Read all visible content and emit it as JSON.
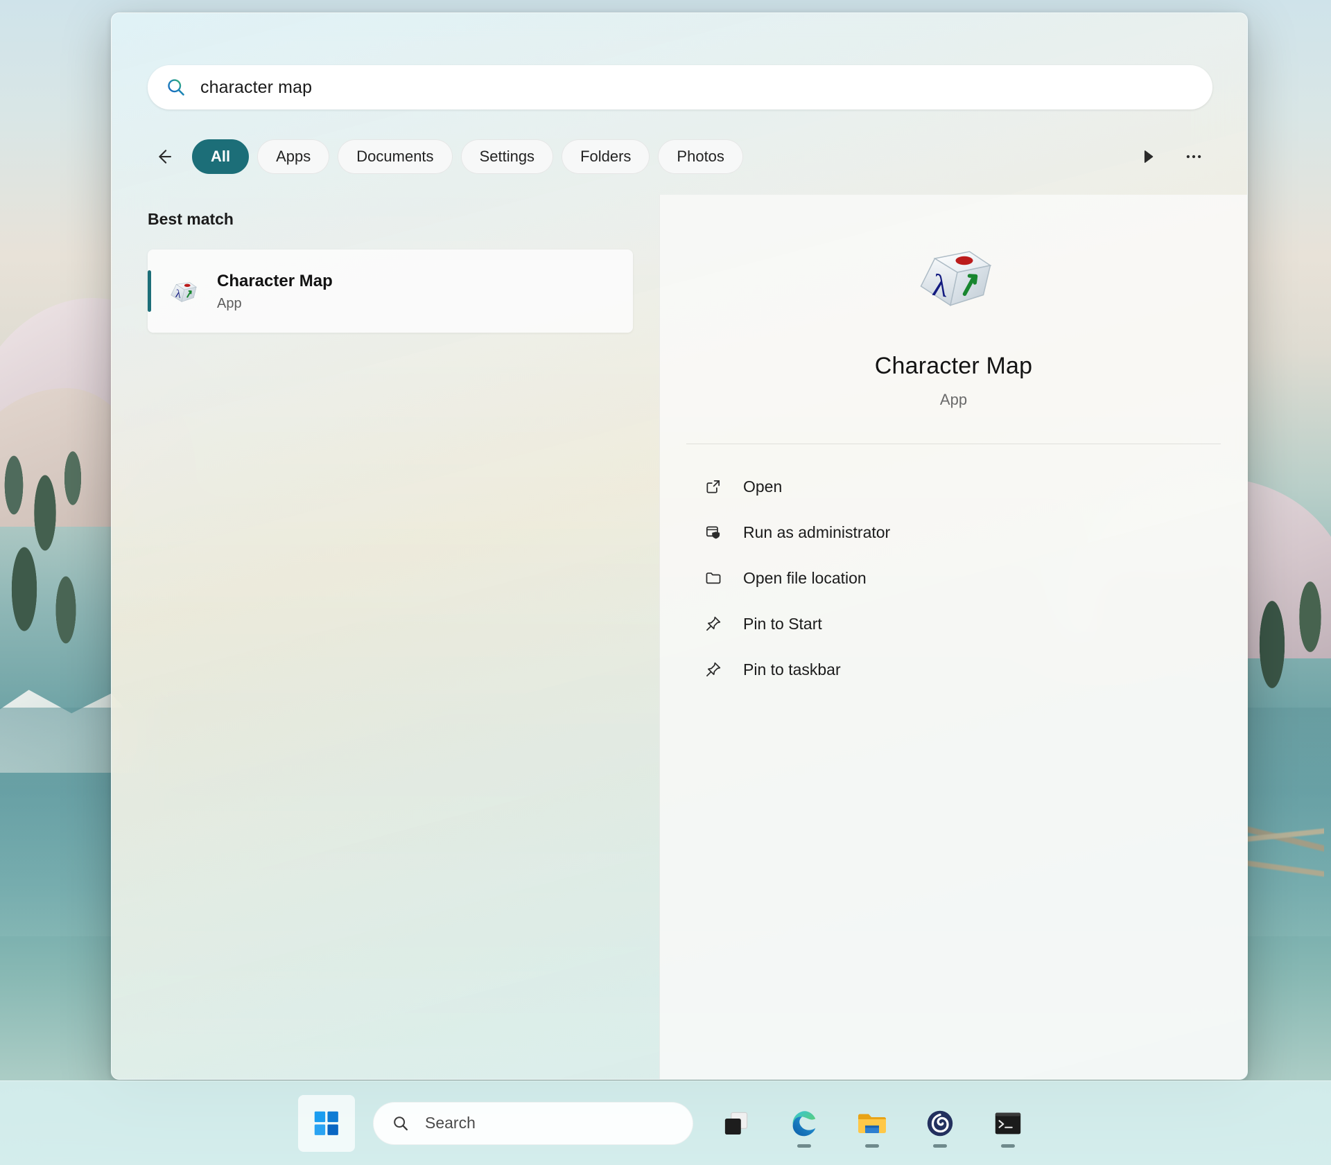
{
  "search": {
    "query": "character map",
    "icon": "search-icon"
  },
  "filters": {
    "back_icon": "back-arrow-icon",
    "tabs": [
      {
        "label": "All",
        "active": true
      },
      {
        "label": "Apps",
        "active": false
      },
      {
        "label": "Documents",
        "active": false
      },
      {
        "label": "Settings",
        "active": false
      },
      {
        "label": "Folders",
        "active": false
      },
      {
        "label": "Photos",
        "active": false
      }
    ],
    "play_icon": "play-icon",
    "more_icon": "ellipsis-icon"
  },
  "results": {
    "section_label": "Best match",
    "item": {
      "title": "Character Map",
      "subtitle": "App",
      "icon": "character-map-app-icon"
    }
  },
  "detail": {
    "icon": "character-map-app-icon",
    "title": "Character Map",
    "subtitle": "App",
    "actions": [
      {
        "label": "Open",
        "icon": "open-external-icon"
      },
      {
        "label": "Run as administrator",
        "icon": "shield-admin-icon"
      },
      {
        "label": "Open file location",
        "icon": "folder-icon"
      },
      {
        "label": "Pin to Start",
        "icon": "pin-icon"
      },
      {
        "label": "Pin to taskbar",
        "icon": "pin-icon"
      }
    ]
  },
  "taskbar": {
    "start_icon": "windows-start-icon",
    "search_placeholder": "Search",
    "search_icon": "search-icon",
    "apps": [
      {
        "name": "task-view",
        "running": false
      },
      {
        "name": "microsoft-edge",
        "running": true
      },
      {
        "name": "file-explorer",
        "running": true
      },
      {
        "name": "power-app",
        "running": true
      },
      {
        "name": "terminal",
        "running": true
      }
    ]
  },
  "colors": {
    "accent_teal": "#1c6e78",
    "selection_bar": "#1c6e78",
    "start_blue": "#0a7bd4"
  }
}
